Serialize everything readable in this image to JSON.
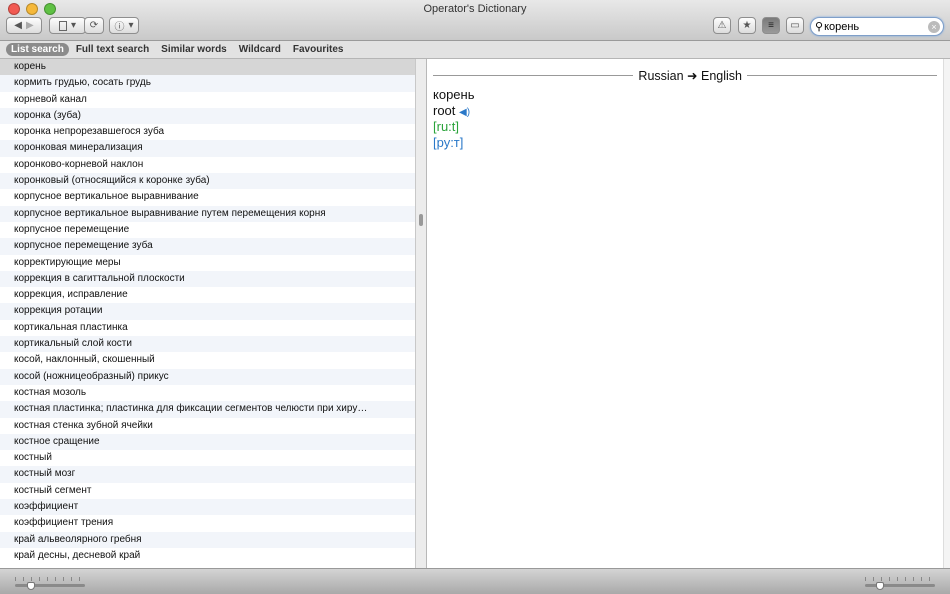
{
  "window": {
    "title": "Operator's Dictionary"
  },
  "toolbar": {
    "back": "◀",
    "forward": "▶",
    "dict_icon": "dictionary-icon",
    "refresh": "⟳",
    "info": "ⓘ",
    "warning": "⚠",
    "star": "★",
    "history": "≡",
    "window": "▭"
  },
  "search": {
    "value": "корень",
    "icon": "search-icon"
  },
  "tabs": [
    {
      "label": "List search",
      "selected": true
    },
    {
      "label": "Full text search"
    },
    {
      "label": "Similar words"
    },
    {
      "label": "Wildcard"
    },
    {
      "label": "Favourites"
    }
  ],
  "list": [
    "корень",
    "кормить грудью, сосать грудь",
    "корневой канал",
    "коронка (зуба)",
    "коронка непрорезавшегося зуба",
    "коронковая минерализация",
    "коронково-корневой наклон",
    "коронковый (относящийся к коронке зуба)",
    "корпусное вертикальное выравнивание",
    "корпусное вертикальное выравнивание путем перемещения корня",
    "корпусное перемещение",
    "корпусное перемещение зуба",
    "корректирующие меры",
    "коррекция в сагиттальной плоскости",
    "коррекция, исправление",
    "коррекция ротации",
    "кортикальная пластинка",
    "кортикальный слой кости",
    "косой, наклонный, скошенный",
    "косой (ножницеобразный) прикус",
    "костная мозоль",
    "костная пластинка; пластинка для фиксации сегментов челюсти при хиру…",
    "костная стенка зубной ячейки",
    "костное сращение",
    "костный",
    "костный мозг",
    "костный сегмент",
    "коэффициент",
    "коэффициент трения",
    "край альвеолярного гребня",
    "край десны, десневой край"
  ],
  "detail": {
    "direction": "Russian ➜ English",
    "headword": "корень",
    "translation": "root",
    "sound_icon": "speaker-icon",
    "phonetic_en": "[ru:t]",
    "phonetic_ru": "[ру:т]"
  },
  "colors": {
    "phonetic_en": "#2aa33a",
    "phonetic_ru": "#2a78c8",
    "selected_row": "#d6d6d6"
  }
}
